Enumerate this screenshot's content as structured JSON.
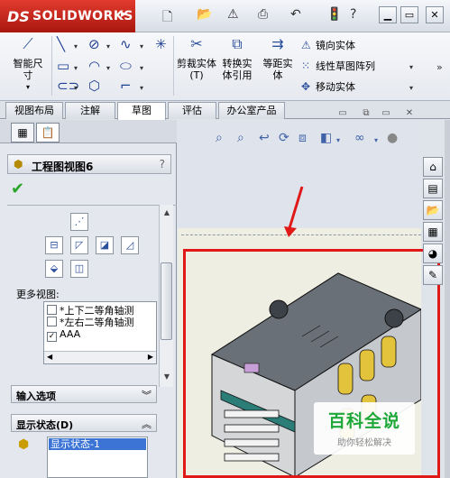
{
  "app": {
    "brand": "SOLIDWORKS",
    "brand_mark": "DS"
  },
  "ribbon": {
    "smart_dimension": "智能尺寸",
    "trim_entities": "剪裁实体(T)",
    "convert_entities": "转换实体引用",
    "offset_entities": "等距实体",
    "mirror_entities": "镜向实体",
    "linear_pattern": "线性草图阵列",
    "move_entities": "移动实体"
  },
  "tabs": [
    {
      "label": "视图布局"
    },
    {
      "label": "注解"
    },
    {
      "label": "草图"
    },
    {
      "label": "评估"
    },
    {
      "label": "办公室产品"
    }
  ],
  "property_manager": {
    "title": "工程图视图6",
    "help": "?",
    "more_views_label": "更多视图:",
    "more_views": [
      {
        "label": "*上下二等角轴测",
        "checked": false
      },
      {
        "label": "*左右二等角轴测",
        "checked": false
      },
      {
        "label": "AAA",
        "checked": true
      }
    ],
    "import_options_label": "输入选项",
    "display_state_label": "显示状态(D)",
    "display_state_item": "显示状态-1"
  },
  "watermark": {
    "title": "百科全说",
    "subtitle": "助你轻松解决"
  },
  "colors": {
    "accent_red": "#e01818",
    "brand_red": "#c9261b",
    "selection_blue": "#3c74d6"
  }
}
